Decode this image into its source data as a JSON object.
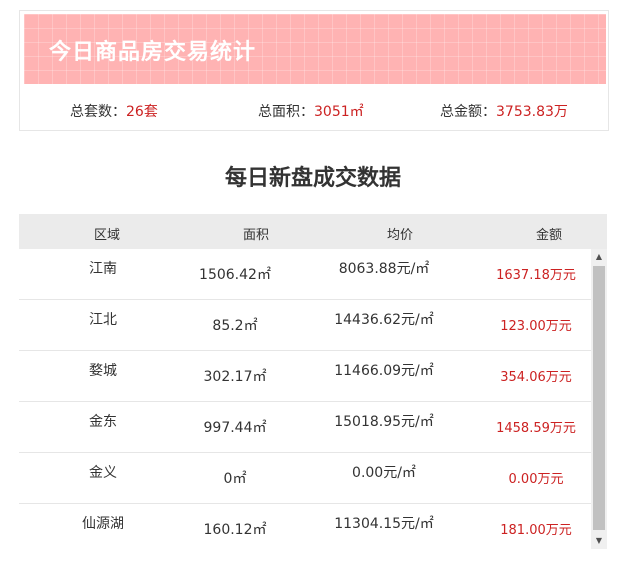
{
  "summary": {
    "title": "今日商品房交易统计",
    "count_label": "总套数：",
    "count_value": "26套",
    "area_label": "总面积：",
    "area_value": "3051㎡",
    "money_label": "总金额：",
    "money_value": "3753.83万"
  },
  "section": {
    "title": "每日新盘成交数据"
  },
  "table": {
    "headers": [
      "区域",
      "面积",
      "均价",
      "金额"
    ],
    "rows": [
      {
        "region": "江南",
        "area": "1506.42㎡",
        "price": "8063.88元/㎡",
        "money": "1637.18万元"
      },
      {
        "region": "江北",
        "area": "85.2㎡",
        "price": "14436.62元/㎡",
        "money": "123.00万元"
      },
      {
        "region": "婺城",
        "area": "302.17㎡",
        "price": "11466.09元/㎡",
        "money": "354.06万元"
      },
      {
        "region": "金东",
        "area": "997.44㎡",
        "price": "15018.95元/㎡",
        "money": "1458.59万元"
      },
      {
        "region": "金义",
        "area": "0㎡",
        "price": "0.00元/㎡",
        "money": "0.00万元"
      },
      {
        "region": "仙源湖",
        "area": "160.12㎡",
        "price": "11304.15元/㎡",
        "money": "181.00万元"
      }
    ]
  },
  "icons": {
    "scroll_up": "scroll-up-arrow-icon",
    "scroll_down": "scroll-down-arrow-icon"
  },
  "colors": {
    "banner": "#ffb3b3",
    "highlight": "#cc2222",
    "header_bg": "#ebebeb"
  }
}
